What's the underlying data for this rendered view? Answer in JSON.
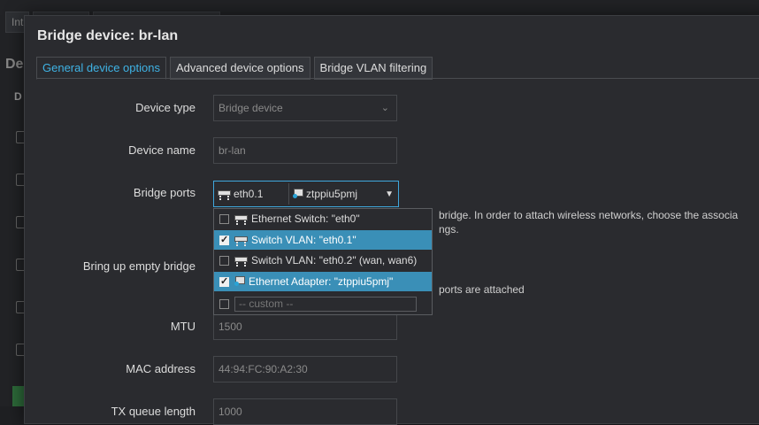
{
  "background": {
    "tabs": [
      "Int",
      "",
      ""
    ],
    "title": "De",
    "column": "D"
  },
  "modal": {
    "title": "Bridge device: br-lan",
    "tabs": [
      "General device options",
      "Advanced device options",
      "Bridge VLAN filtering"
    ]
  },
  "form": {
    "device_type": {
      "label": "Device type",
      "value": "Bridge device"
    },
    "device_name": {
      "label": "Device name",
      "value": "br-lan"
    },
    "bridge_ports": {
      "label": "Bridge ports",
      "selected": [
        "eth0.1",
        "ztppiu5pmj"
      ],
      "options": [
        {
          "label": "Ethernet Switch: \"eth0\"",
          "checked": false,
          "icon": "switch-icon"
        },
        {
          "label": "Switch VLAN: \"eth0.1\"",
          "checked": true,
          "icon": "switch-icon"
        },
        {
          "label": "Switch VLAN: \"eth0.2\" (wan, wan6)",
          "checked": false,
          "icon": "switch-icon"
        },
        {
          "label": "Ethernet Adapter: \"ztppiu5pmj\"",
          "checked": true,
          "icon": "ethernet-adapter-icon"
        }
      ],
      "custom_placeholder": "-- custom --",
      "desc_line1": "bridge. In order to attach wireless networks, choose the associa",
      "desc_line2": "ngs."
    },
    "bring_up": {
      "label": "Bring up empty bridge",
      "desc": "ports are attached"
    },
    "mtu": {
      "label": "MTU",
      "value": "1500"
    },
    "mac": {
      "label": "MAC address",
      "value": "44:94:FC:90:A2:30"
    },
    "tx_queue": {
      "label": "TX queue length",
      "value": "1000"
    }
  }
}
